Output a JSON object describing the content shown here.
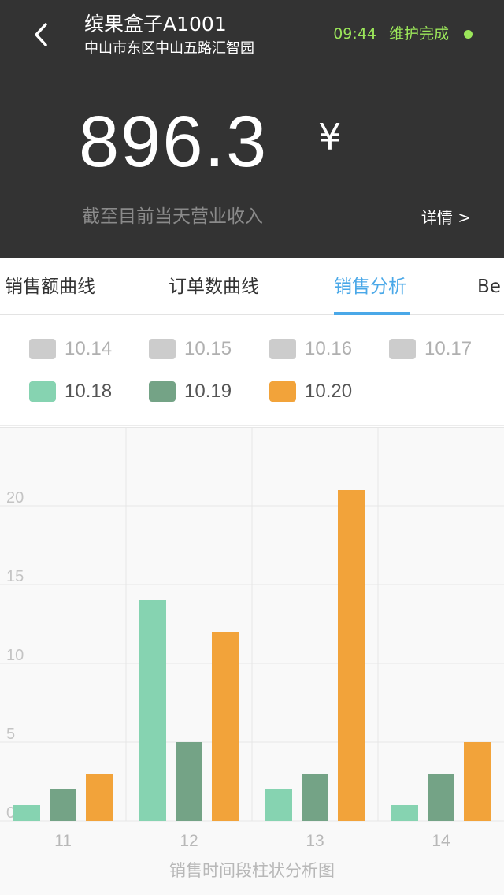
{
  "header": {
    "title": "缤果盒子A1001",
    "address": "中山市东区中山五路汇智园",
    "time": "09:44",
    "status": "维护完成",
    "amount": "896.3",
    "currency": "¥",
    "caption": "截至目前当天营业收入",
    "detail_link": "详情 >",
    "status_color": "#9be65a"
  },
  "tabs": [
    {
      "label": "销售额曲线",
      "active": false
    },
    {
      "label": "订单数曲线",
      "active": false
    },
    {
      "label": "销售分析",
      "active": true
    },
    {
      "label": "Be",
      "active": false
    }
  ],
  "legend": [
    {
      "label": "10.14",
      "color": "#cccccc",
      "text_color": "#b0b0b0"
    },
    {
      "label": "10.15",
      "color": "#cccccc",
      "text_color": "#b0b0b0"
    },
    {
      "label": "10.16",
      "color": "#cccccc",
      "text_color": "#b0b0b0"
    },
    {
      "label": "10.17",
      "color": "#cccccc",
      "text_color": "#b0b0b0"
    },
    {
      "label": "10.18",
      "color": "#86d3b1",
      "text_color": "#555555"
    },
    {
      "label": "10.19",
      "color": "#74a386",
      "text_color": "#555555"
    },
    {
      "label": "10.20",
      "color": "#f2a33a",
      "text_color": "#555555"
    }
  ],
  "chart_data": {
    "type": "bar",
    "categories": [
      "11",
      "12",
      "13",
      "14"
    ],
    "series": [
      {
        "name": "10.18",
        "color": "#86d3b1",
        "values": [
          1,
          14,
          2,
          1
        ]
      },
      {
        "name": "10.19",
        "color": "#74a386",
        "values": [
          2,
          5,
          3,
          3
        ]
      },
      {
        "name": "10.20",
        "color": "#f2a33a",
        "values": [
          3,
          12,
          21,
          5
        ]
      }
    ],
    "y_ticks": [
      "0",
      "5",
      "10",
      "15",
      "20"
    ],
    "ylim": [
      0,
      25
    ],
    "xlabel": "销售时间段柱状分析图",
    "grid": true
  }
}
